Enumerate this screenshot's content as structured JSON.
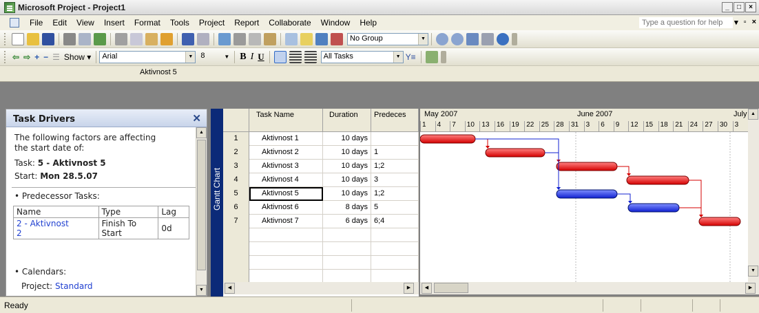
{
  "window": {
    "title": "Microsoft Project - Project1"
  },
  "menu": {
    "items": [
      "File",
      "Edit",
      "View",
      "Insert",
      "Format",
      "Tools",
      "Project",
      "Report",
      "Collaborate",
      "Window",
      "Help"
    ],
    "help_placeholder": "Type a question for help"
  },
  "toolbar1": {
    "group_value": "No Group"
  },
  "toolbar2": {
    "show_label": "Show",
    "font_value": "Arial",
    "size_value": "8",
    "bold_label": "B",
    "italic_label": "I",
    "underline_label": "U",
    "filter_value": "All Tasks"
  },
  "entry_bar": {
    "value": "Aktivnost 5"
  },
  "task_drivers": {
    "title": "Task Drivers",
    "intro_line1": "The following factors are affecting",
    "intro_line2": "the start date of:",
    "task_label": "Task:",
    "task_value": "5 - Aktivnost 5",
    "start_label": "Start:",
    "start_value": "Mon 28.5.07",
    "predecessor_heading": "• Predecessor Tasks:",
    "table_headers": [
      "Name",
      "Type",
      "Lag"
    ],
    "predecessor": {
      "name_line1": "2 - Aktivnost",
      "name_line2": "2",
      "type_line1": "Finish To",
      "type_line2": "Start",
      "lag": "0d"
    },
    "calendars_heading": "• Calendars:",
    "project_label": "Project:",
    "project_value": "Standard"
  },
  "view_bar": {
    "label": "Gantt Chart"
  },
  "sheet": {
    "headers": {
      "name": "Task Name",
      "duration": "Duration",
      "predecessors": "Predeces"
    },
    "rows": [
      {
        "id": "1",
        "name": "Aktivnost 1",
        "duration": "10 days",
        "pred": ""
      },
      {
        "id": "2",
        "name": "Aktivnost 2",
        "duration": "10 days",
        "pred": "1"
      },
      {
        "id": "3",
        "name": "Aktivnost 3",
        "duration": "10 days",
        "pred": "1;2"
      },
      {
        "id": "4",
        "name": "Aktivnost 4",
        "duration": "10 days",
        "pred": "3"
      },
      {
        "id": "5",
        "name": "Aktivnost 5",
        "duration": "10 days",
        "pred": "1;2"
      },
      {
        "id": "6",
        "name": "Aktivnost 6",
        "duration": "8 days",
        "pred": "5"
      },
      {
        "id": "7",
        "name": "Aktivnost 7",
        "duration": "6 days",
        "pred": "6;4"
      }
    ]
  },
  "gantt": {
    "months": [
      "May 2007",
      "June 2007",
      "July"
    ],
    "days": [
      "1",
      "4",
      "7",
      "10",
      "13",
      "16",
      "19",
      "22",
      "25",
      "28",
      "31",
      "3",
      "6",
      "9",
      "12",
      "15",
      "18",
      "21",
      "24",
      "27",
      "30",
      "3"
    ],
    "colors": {
      "critical": "#d40000",
      "noncritical": "#1020d0"
    },
    "bars": [
      {
        "task": "1",
        "type": "critical"
      },
      {
        "task": "2",
        "type": "critical"
      },
      {
        "task": "3",
        "type": "critical"
      },
      {
        "task": "4",
        "type": "critical"
      },
      {
        "task": "5",
        "type": "noncritical"
      },
      {
        "task": "6",
        "type": "noncritical"
      },
      {
        "task": "7",
        "type": "critical"
      }
    ]
  },
  "status": {
    "text": "Ready"
  }
}
